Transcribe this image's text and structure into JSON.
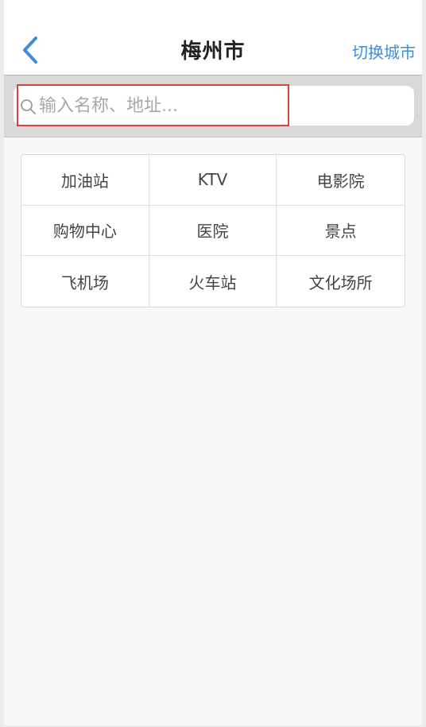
{
  "header": {
    "title": "梅州市",
    "switch_city_label": "切换城市",
    "back_icon": "chevron-left-icon",
    "accent_color": "#3e8ddb"
  },
  "search": {
    "placeholder": "输入名称、地址...",
    "value": "",
    "icon": "search-icon"
  },
  "categories": [
    {
      "label": "加油站"
    },
    {
      "label": "KTV"
    },
    {
      "label": "电影院"
    },
    {
      "label": "购物中心"
    },
    {
      "label": "医院"
    },
    {
      "label": "景点"
    },
    {
      "label": "飞机场"
    },
    {
      "label": "火车站"
    },
    {
      "label": "文化场所"
    }
  ]
}
